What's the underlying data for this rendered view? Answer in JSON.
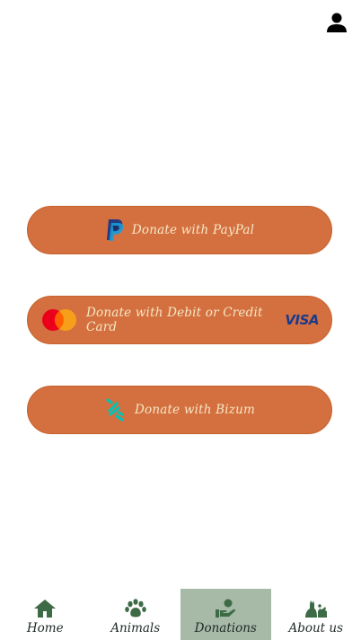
{
  "header": {
    "profile_icon": "user-icon"
  },
  "donations": {
    "paypal": {
      "label": "Donate with PayPal",
      "icon": "paypal-icon"
    },
    "card": {
      "label": "Donate with Debit or Credit Card",
      "icon": "mastercard-icon",
      "brand": "VISA"
    },
    "bizum": {
      "label": "Donate with Bizum",
      "icon": "bizum-icon"
    }
  },
  "nav": {
    "active": "Donations",
    "tabs": [
      {
        "label": "Home",
        "icon": "home-icon"
      },
      {
        "label": "Animals",
        "icon": "paw-icon"
      },
      {
        "label": "Donations",
        "icon": "donation-hand-icon"
      },
      {
        "label": "About us",
        "icon": "pets-icon"
      }
    ]
  },
  "colors": {
    "button_bg": "#d4703f",
    "button_text": "#f6e7c6",
    "nav_active_bg": "#a7b9a7",
    "nav_icon": "#3d6b45"
  }
}
